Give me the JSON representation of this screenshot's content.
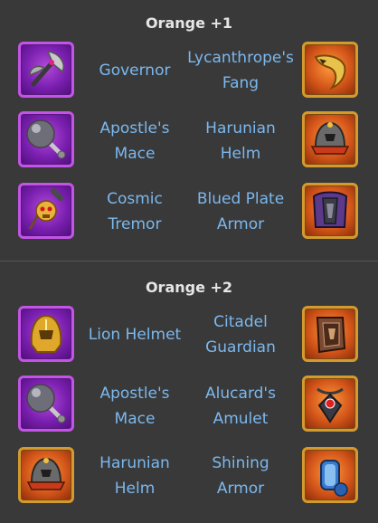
{
  "sections": [
    {
      "title": "Orange +1",
      "rows": [
        {
          "left_name": "Governor",
          "right_name": "Lycanthrope's Fang"
        },
        {
          "left_name": "Apostle's Mace",
          "right_name": "Harunian Helm"
        },
        {
          "left_name": "Cosmic Tremor",
          "right_name": "Blued Plate Armor"
        }
      ]
    },
    {
      "title": "Orange +2",
      "rows": [
        {
          "left_name": "Lion Helmet",
          "right_name": "Citadel Guardian"
        },
        {
          "left_name": "Apostle's Mace",
          "right_name": "Alucard's Amulet"
        },
        {
          "left_name": "Harunian Helm",
          "right_name": "Shining Armor"
        }
      ]
    }
  ],
  "icons": {
    "s0r0_left": "axe-icon",
    "s0r0_right": "fang-icon",
    "s0r1_left": "mace-icon",
    "s0r1_right": "helm-icon",
    "s0r2_left": "skull-staff-icon",
    "s0r2_right": "plate-armor-icon",
    "s1r0_left": "lion-helmet-icon",
    "s1r0_right": "shield-icon",
    "s1r1_left": "mace-icon",
    "s1r1_right": "amulet-icon",
    "s1r2_left": "helm-icon",
    "s1r2_right": "armor-icon"
  },
  "colors": {
    "background": "#393939",
    "title": "#e6e6e6",
    "item_name": "#7bb8ee",
    "frame_purple": "#c254e6",
    "frame_orange": "#d49a2e"
  }
}
